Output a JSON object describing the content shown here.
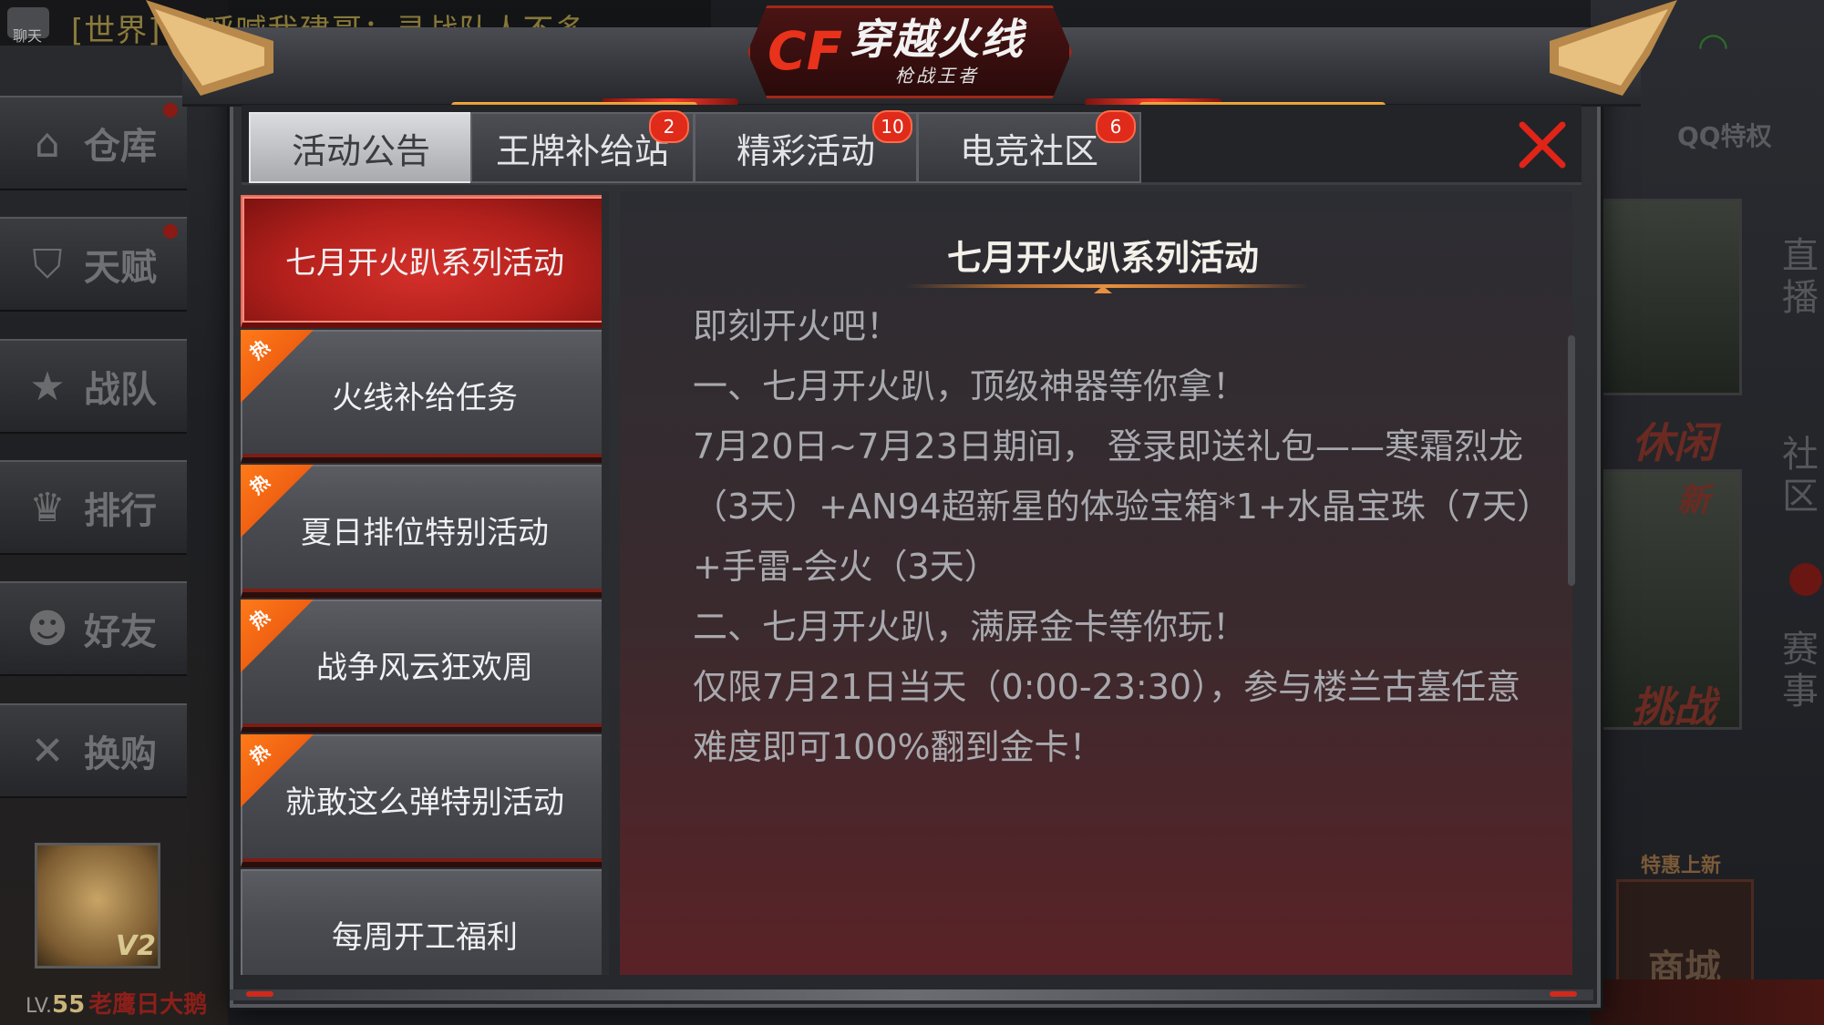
{
  "chat": {
    "label": "聊天",
    "message": "[世界] 请呼喊我建哥：寻战队人不多"
  },
  "sidebar": {
    "items": [
      {
        "label": "仓库",
        "icon": "warehouse-icon"
      },
      {
        "label": "天赋",
        "icon": "talent-icon"
      },
      {
        "label": "战队",
        "icon": "clan-star-icon"
      },
      {
        "label": "排行",
        "icon": "trophy-icon"
      },
      {
        "label": "好友",
        "icon": "friends-icon"
      },
      {
        "label": "换购",
        "icon": "tools-icon"
      }
    ]
  },
  "player": {
    "vip": "V2",
    "level_prefix": "LV.",
    "level": "55",
    "name": "老鹰日大鹅"
  },
  "right_panel": {
    "qq_privilege": "QQ特权",
    "vertical_labels": [
      "直播",
      "社区",
      "赛事"
    ],
    "tiles": [
      "休闲",
      "新",
      "挑战"
    ],
    "shop_promo": "特惠上新",
    "shop": "商城"
  },
  "logo": {
    "cf": "CF",
    "title": "穿越火线",
    "subtitle": "枪战王者"
  },
  "tabs": [
    {
      "label": "活动公告",
      "badge": ""
    },
    {
      "label": "王牌补给站",
      "badge": "2"
    },
    {
      "label": "精彩活动",
      "badge": "10"
    },
    {
      "label": "电竞社区",
      "badge": "6"
    }
  ],
  "activities": [
    {
      "label": "七月开火趴系列活动",
      "hot": false,
      "active": true
    },
    {
      "label": "火线补给任务",
      "hot": true,
      "active": false
    },
    {
      "label": "夏日排位特别活动",
      "hot": true,
      "active": false
    },
    {
      "label": "战争风云狂欢周",
      "hot": true,
      "active": false
    },
    {
      "label": "就敢这么弹特别活动",
      "hot": true,
      "active": false
    },
    {
      "label": "每周开工福利",
      "hot": false,
      "active": false
    }
  ],
  "hot_tag": "热",
  "content": {
    "title": "七月开火趴系列活动",
    "paragraphs": [
      "即刻开火吧！",
      "",
      "一、七月开火趴，顶级神器等你拿！",
      "7月20日~7月23日期间， 登录即送礼包——寒霜烈龙（3天）+AN94超新星的体验宝箱*1+水晶宝珠（7天）+手雷-会火（3天）",
      "",
      "二、七月开火趴，满屏金卡等你玩！",
      "仅限7月21日当天（0:00-23:30），参与楼兰古墓任意难度即可100%翻到金卡！"
    ]
  },
  "colors": {
    "accent_red": "#d0261c",
    "badge_red": "#e02a1a",
    "hot_orange": "#f06a12",
    "text_body": "#a8a9ae"
  }
}
